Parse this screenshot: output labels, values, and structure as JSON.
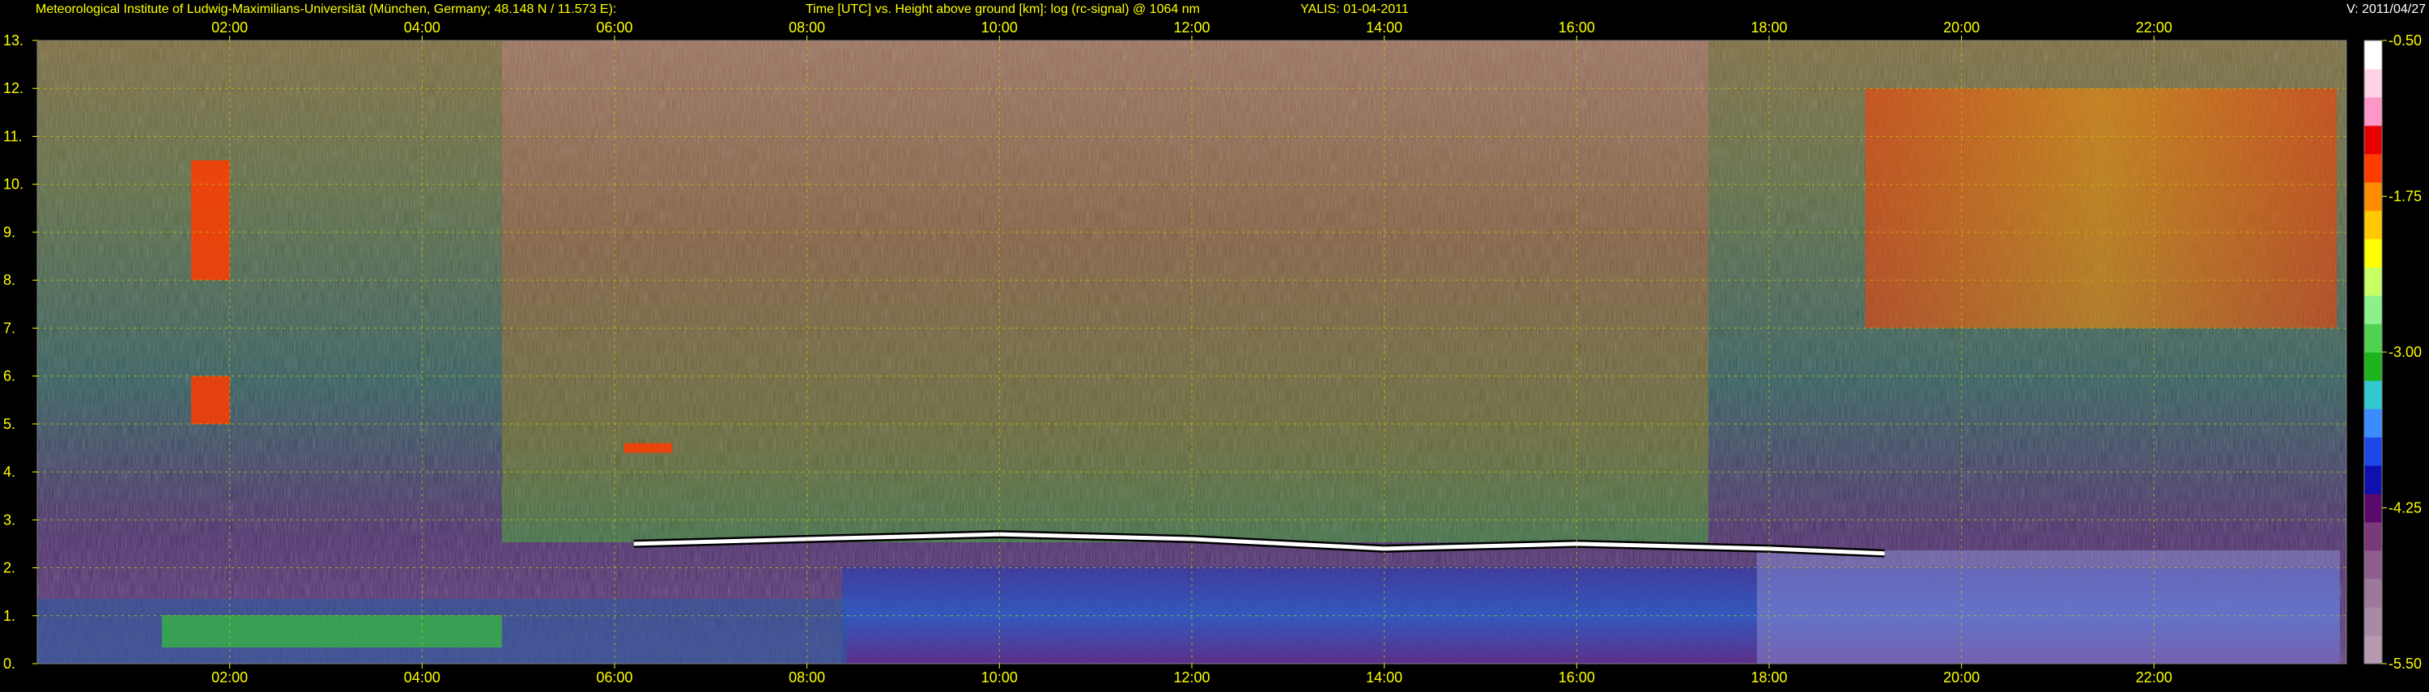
{
  "header": {
    "institute": "Meteorological Institute of Ludwig-Maximilians-Universität (München, Germany; 48.148 N / 11.573 E):",
    "plot_title": "Time [UTC] vs. Height above ground [km]: log (rc-signal) @ 1064 nm",
    "instrument_date": "YALIS: 01-04-2011",
    "version": "V: 2011/04/27"
  },
  "colors": {
    "text": "#ffff00",
    "grid": "#c8c800",
    "background": "#000000",
    "version_text": "#ffffff"
  },
  "chart_data": {
    "type": "heatmap",
    "title": "Time [UTC] vs. Height above ground [km]: log (rc-signal) @ 1064 nm",
    "xlabel": "Time [UTC]",
    "ylabel": "Height above ground [km]",
    "xlim": [
      0,
      24
    ],
    "ylim": [
      0,
      13
    ],
    "x_ticks": [
      2,
      4,
      6,
      8,
      10,
      12,
      14,
      16,
      18,
      20,
      22
    ],
    "x_tick_labels": [
      "02:00",
      "04:00",
      "06:00",
      "08:00",
      "10:00",
      "12:00",
      "14:00",
      "16:00",
      "18:00",
      "20:00",
      "22:00"
    ],
    "y_ticks": [
      0,
      1,
      2,
      3,
      4,
      5,
      6,
      7,
      8,
      9,
      10,
      11,
      12,
      13
    ],
    "y_tick_labels": [
      "0.",
      "1.",
      "2.",
      "3.",
      "4.",
      "5.",
      "6.",
      "7.",
      "8.",
      "9.",
      "10.",
      "11.",
      "12.",
      "13."
    ],
    "grid": true,
    "colorbar": {
      "range": [
        -5.5,
        -0.5
      ],
      "ticks": [
        -0.5,
        -1.75,
        -3.0,
        -4.25,
        -5.5
      ],
      "tick_labels": [
        "-0.50",
        "-1.75",
        "-3.00",
        "-4.25",
        "-5.50"
      ],
      "colors": [
        "#b59ab0",
        "#a98aa5",
        "#9c789a",
        "#8e5f8e",
        "#7a3a7a",
        "#5a0a6a",
        "#1010b0",
        "#1e46e6",
        "#3c8cff",
        "#32c8d2",
        "#1eb41e",
        "#50d250",
        "#8cf08c",
        "#c8ff64",
        "#ffff00",
        "#ffc800",
        "#ff8c00",
        "#ff3c00",
        "#e60000",
        "#ff96c8",
        "#ffd2e6",
        "#ffffff"
      ]
    },
    "features": [
      {
        "label": "boundary layer top",
        "x": [
          6.2,
          8,
          10,
          12,
          14,
          16,
          18,
          19.2
        ],
        "y": [
          2.5,
          2.6,
          2.7,
          2.6,
          2.4,
          2.5,
          2.4,
          2.3
        ]
      },
      {
        "label": "cirrus",
        "x": [
          19,
          23.9
        ],
        "y": [
          7,
          12
        ]
      },
      {
        "label": "cloud layer",
        "x": [
          1.6,
          2.0
        ],
        "y": [
          8,
          10.5
        ]
      },
      {
        "label": "cloud layer",
        "x": [
          1.6,
          2.0
        ],
        "y": [
          5,
          6
        ]
      },
      {
        "label": "cloud layer",
        "x": [
          6.1,
          6.6
        ],
        "y": [
          4.4,
          4.6
        ]
      }
    ]
  }
}
